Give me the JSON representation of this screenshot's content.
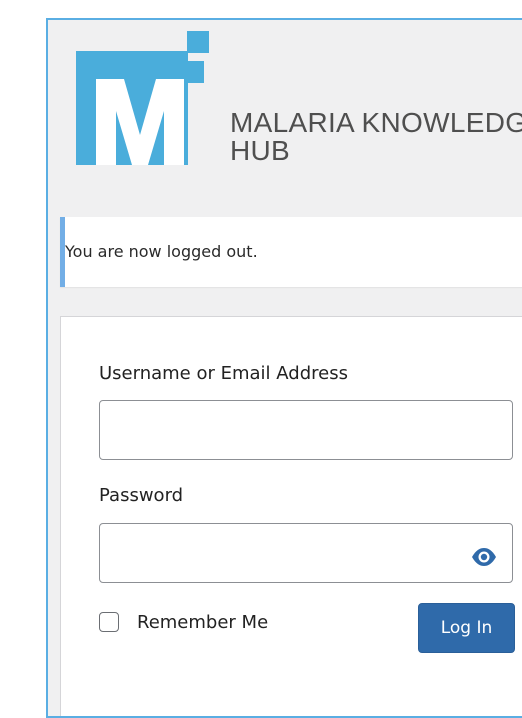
{
  "brand": {
    "logo_icon": "malaria-knowledge-hub-logo",
    "title_line1": "MALARIA KNOWLEDGE",
    "title_line2": "HUB",
    "logo_color": "#4aaddb"
  },
  "notice": {
    "message": "You are now logged out.",
    "accent_color": "#72aee6"
  },
  "login_form": {
    "username_label": "Username or Email Address",
    "username_value": "",
    "password_label": "Password",
    "password_value": "",
    "show_password_icon": "eye-icon",
    "remember_label": "Remember Me",
    "remember_checked": false,
    "submit_label": "Log In",
    "button_color": "#2f6aaa"
  }
}
